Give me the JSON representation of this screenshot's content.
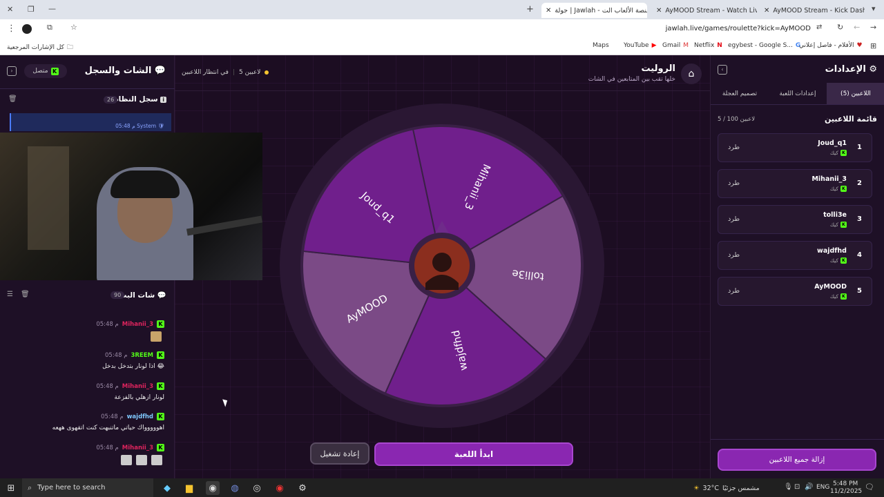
{
  "browser": {
    "tabs": [
      {
        "title": "AyMOOD Stream - Kick Dashb"
      },
      {
        "title": "AyMOOD Stream - Watch Live"
      },
      {
        "title": "جولة | Jawlah - منصة الألعاب الت"
      }
    ],
    "url": "jawlah.live/games/roulette?kick=AyMOOD",
    "bookmarks": [
      {
        "label": "كل الإشارات المرجعية"
      },
      {
        "label": "Maps"
      },
      {
        "label": "YouTube"
      },
      {
        "label": "Gmail"
      },
      {
        "label": "Netflix"
      },
      {
        "label": "egybest - Google S..."
      },
      {
        "label": "الأفلام - فاصل إعلاني"
      }
    ]
  },
  "left": {
    "title": "الشات والسجل",
    "status": "متصل",
    "system_log": {
      "title": "سجل النظام",
      "count": "26",
      "entry_user": "System",
      "entry_time": "05:48 م"
    },
    "stream_chat": {
      "title": "شات البث",
      "count": "90"
    },
    "messages": [
      {
        "user": "Mihanii_3",
        "time": "05:48 م",
        "text": ""
      },
      {
        "user": "3REEM",
        "time": "05:48 م",
        "text": "اذا لونار بتدخل بدخل 😂"
      },
      {
        "user": "Mihanii_3",
        "time": "05:48 م",
        "text": "لونار ازهلي بالفزعة"
      },
      {
        "user": "wajdfhd",
        "time": "05:48 م",
        "text": "اهووووواك حياتي ماتنبهت كنت اتقهوى ههعه"
      },
      {
        "user": "Mihanii_3",
        "time": "05:48 م",
        "text": ""
      }
    ]
  },
  "center": {
    "title": "الروليت",
    "subtitle": "خلها تقب بين المتابعين في الشات",
    "players_count": "5 لاعبين",
    "waiting": "في انتظار اللاعبين",
    "wheel_segments": [
      "Mihanii_3",
      "tolli3e",
      "wajdfhd",
      "AyMOOD",
      "Joud_q1"
    ],
    "start_button": "ابدأ اللعبة",
    "restart_button": "إعادة تشغيل"
  },
  "right": {
    "title": "الإعدادات",
    "tabs": [
      "اللاعبين (5)",
      "إعدادات اللعبة",
      "تصميم العجلة"
    ],
    "list_title": "قائمة اللاعبين",
    "list_count": "5 / 100 لاعبين",
    "platform": "كيك",
    "kick_label": "طرد",
    "players": [
      {
        "rank": "1",
        "name": "Joud_q1"
      },
      {
        "rank": "2",
        "name": "Mihanii_3"
      },
      {
        "rank": "3",
        "name": "tolli3e"
      },
      {
        "rank": "4",
        "name": "wajdfhd"
      },
      {
        "rank": "5",
        "name": "AyMOOD"
      }
    ],
    "remove_all": "إزالة جميع اللاعبين"
  },
  "taskbar": {
    "search": "Type here to search",
    "weather_temp": "32°C",
    "weather_text": "مشمس جزئيًا",
    "lang": "ENG",
    "time": "5:48 PM",
    "date": "11/2/2025"
  },
  "colors": {
    "accent": "#8a27b1",
    "dark_seg": "#701f8c",
    "light_seg": "#7b4a86",
    "kick": "#53fc18"
  }
}
